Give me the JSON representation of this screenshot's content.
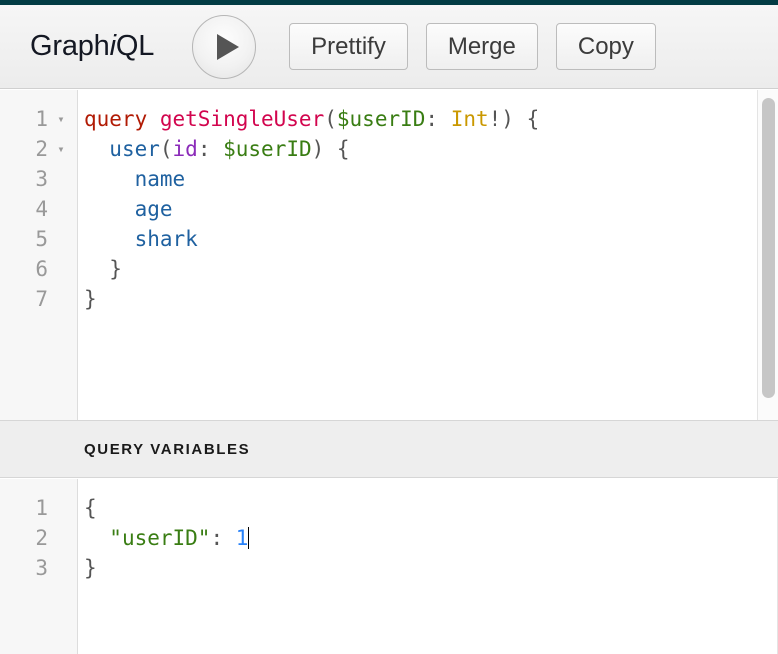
{
  "theme": {
    "accent_bar": "#023c44",
    "toolbar_bg": "#ececec",
    "editor_bg": "#ffffff",
    "gutter_bg": "#f7f7f7",
    "vars_header_bg": "#eeeeee",
    "token_keyword": "#b11a04",
    "token_def": "#d2054e",
    "token_variable": "#397d13",
    "token_attribute": "#8b2bb9",
    "token_type": "#ca9800",
    "token_property": "#1f61a0",
    "token_string": "#397d13",
    "token_number": "#2882f9",
    "token_punctuation": "#555555"
  },
  "toolbar": {
    "logo_prefix": "Graph",
    "logo_italic": "i",
    "logo_suffix": "QL",
    "execute_icon": "play-icon",
    "execute_label": "Execute Query",
    "buttons": [
      {
        "label": "Prettify",
        "name": "prettify-button"
      },
      {
        "label": "Merge",
        "name": "merge-button"
      },
      {
        "label": "Copy",
        "name": "copy-button"
      }
    ]
  },
  "query_editor": {
    "name": "query-editor",
    "line_numbers": [
      "1",
      "2",
      "3",
      "4",
      "5",
      "6",
      "7"
    ],
    "fold_markers": [
      "▾",
      "▾",
      "",
      "",
      "",
      "",
      ""
    ],
    "lines": [
      [
        {
          "text": "query ",
          "token": "keyword"
        },
        {
          "text": "getSingleUser",
          "token": "def"
        },
        {
          "text": "(",
          "token": "punct"
        },
        {
          "text": "$userID",
          "token": "variable"
        },
        {
          "text": ": ",
          "token": "punct"
        },
        {
          "text": "Int",
          "token": "type"
        },
        {
          "text": "!) {",
          "token": "punct"
        }
      ],
      [
        {
          "text": "  ",
          "token": "punct"
        },
        {
          "text": "user",
          "token": "property"
        },
        {
          "text": "(",
          "token": "punct"
        },
        {
          "text": "id",
          "token": "attribute"
        },
        {
          "text": ": ",
          "token": "punct"
        },
        {
          "text": "$userID",
          "token": "variable"
        },
        {
          "text": ") {",
          "token": "punct"
        }
      ],
      [
        {
          "text": "    ",
          "token": "punct"
        },
        {
          "text": "name",
          "token": "property"
        }
      ],
      [
        {
          "text": "    ",
          "token": "punct"
        },
        {
          "text": "age",
          "token": "property"
        }
      ],
      [
        {
          "text": "    ",
          "token": "punct"
        },
        {
          "text": "shark",
          "token": "property"
        }
      ],
      [
        {
          "text": "  }",
          "token": "punct"
        }
      ],
      [
        {
          "text": "}",
          "token": "punct"
        }
      ]
    ],
    "scrollbar": {
      "name": "query-editor-scrollbar"
    }
  },
  "variables_section": {
    "header_label": "QUERY VARIABLES",
    "name": "query-variables-section"
  },
  "variables_editor": {
    "name": "variables-editor",
    "line_numbers": [
      "1",
      "2",
      "3"
    ],
    "lines": [
      [
        {
          "text": "{",
          "token": "punct"
        }
      ],
      [
        {
          "text": "  ",
          "token": "punct"
        },
        {
          "text": "\"userID\"",
          "token": "string"
        },
        {
          "text": ": ",
          "token": "punct"
        },
        {
          "text": "1",
          "token": "number"
        },
        {
          "text": "",
          "token": "caret"
        }
      ],
      [
        {
          "text": "}",
          "token": "punct"
        }
      ]
    ]
  }
}
